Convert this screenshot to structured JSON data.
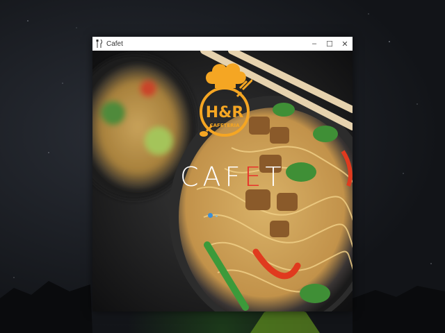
{
  "window": {
    "title": "Cafet",
    "minimize_symbol": "–",
    "maximize_symbol": "☐",
    "close_symbol": "✕",
    "app_icon": "fork-knife-icon"
  },
  "splash": {
    "logo_initials": "H&R",
    "logo_subtitle": "CAFETERIA",
    "brand_part1": "CAF",
    "brand_accent": "E",
    "brand_part2": "T",
    "accent_color": "#e8322a",
    "logo_color": "#f5a623",
    "loader_color": "#3d8fd6"
  }
}
